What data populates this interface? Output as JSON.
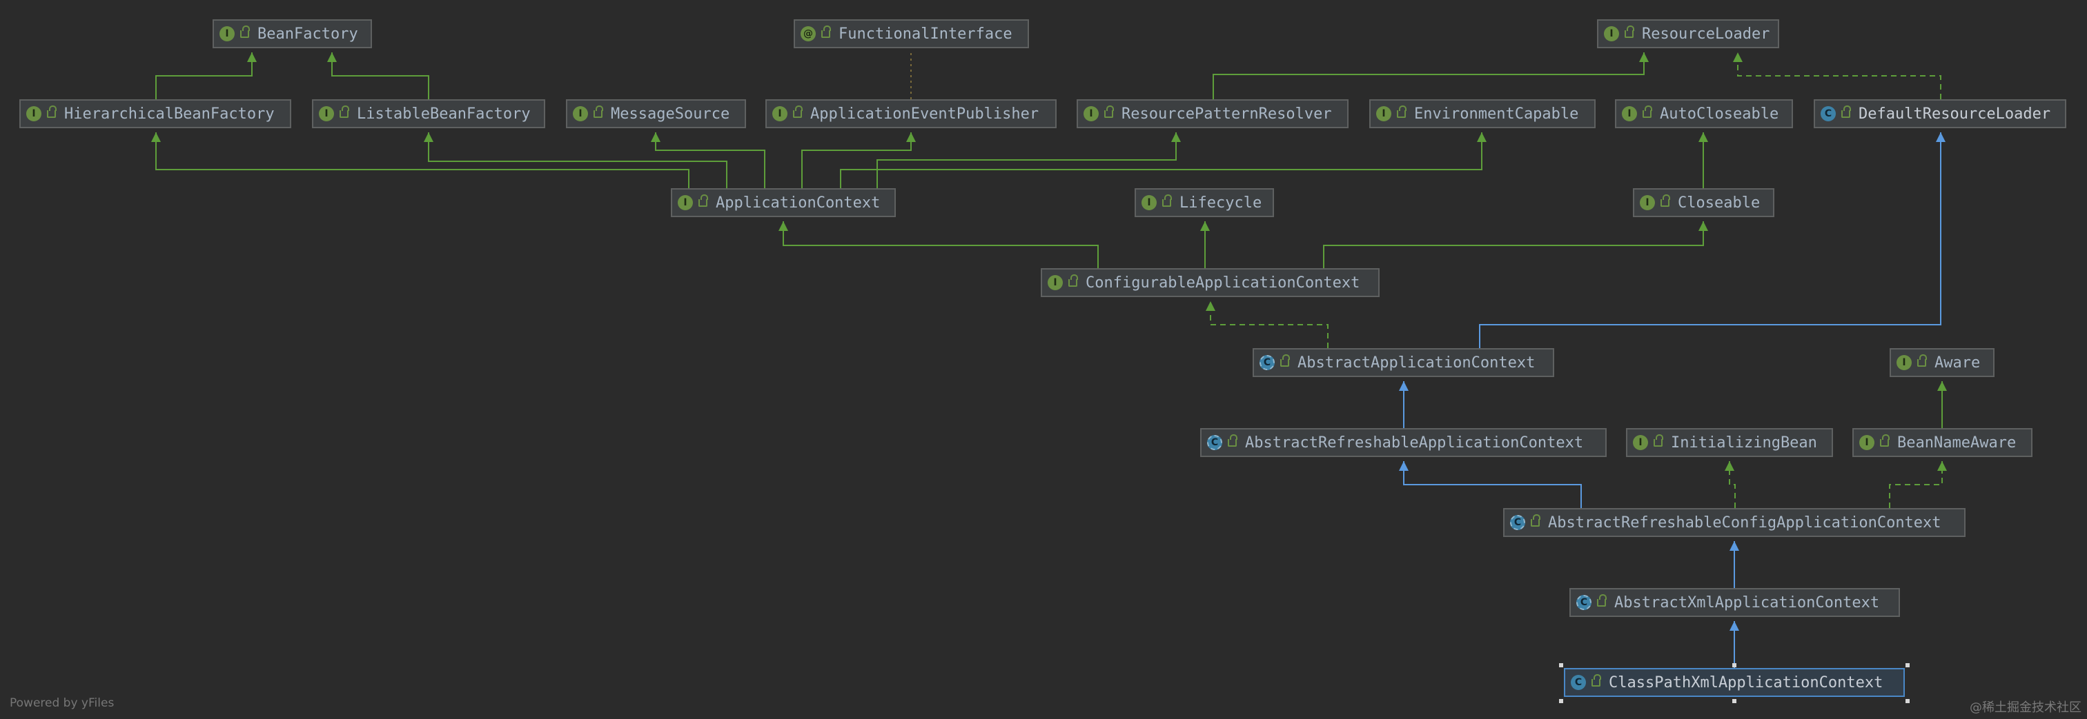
{
  "colors": {
    "background": "#2b2b2b",
    "node_fill": "#3c3f41",
    "node_border": "#5e6060",
    "extends_interface": "#5e9e3a",
    "implements": "#5e9e3a",
    "extends_class": "#5b9ae0",
    "selected_border": "#4a88c7"
  },
  "nodes": [
    {
      "id": "BeanFactory",
      "label": "BeanFactory",
      "kind": "interface"
    },
    {
      "id": "FunctionalInterface",
      "label": "FunctionalInterface",
      "kind": "annotation"
    },
    {
      "id": "ResourceLoader",
      "label": "ResourceLoader",
      "kind": "interface"
    },
    {
      "id": "HierarchicalBeanFactory",
      "label": "HierarchicalBeanFactory",
      "kind": "interface"
    },
    {
      "id": "ListableBeanFactory",
      "label": "ListableBeanFactory",
      "kind": "interface"
    },
    {
      "id": "MessageSource",
      "label": "MessageSource",
      "kind": "interface"
    },
    {
      "id": "ApplicationEventPublisher",
      "label": "ApplicationEventPublisher",
      "kind": "interface"
    },
    {
      "id": "ResourcePatternResolver",
      "label": "ResourcePatternResolver",
      "kind": "interface"
    },
    {
      "id": "EnvironmentCapable",
      "label": "EnvironmentCapable",
      "kind": "interface"
    },
    {
      "id": "AutoCloseable",
      "label": "AutoCloseable",
      "kind": "interface"
    },
    {
      "id": "DefaultResourceLoader",
      "label": "DefaultResourceLoader",
      "kind": "class"
    },
    {
      "id": "ApplicationContext",
      "label": "ApplicationContext",
      "kind": "interface"
    },
    {
      "id": "Lifecycle",
      "label": "Lifecycle",
      "kind": "interface"
    },
    {
      "id": "Closeable",
      "label": "Closeable",
      "kind": "interface"
    },
    {
      "id": "ConfigurableApplicationContext",
      "label": "ConfigurableApplicationContext",
      "kind": "interface"
    },
    {
      "id": "AbstractApplicationContext",
      "label": "AbstractApplicationContext",
      "kind": "abstract-class"
    },
    {
      "id": "Aware",
      "label": "Aware",
      "kind": "interface"
    },
    {
      "id": "AbstractRefreshableApplicationContext",
      "label": "AbstractRefreshableApplicationContext",
      "kind": "abstract-class"
    },
    {
      "id": "InitializingBean",
      "label": "InitializingBean",
      "kind": "interface"
    },
    {
      "id": "BeanNameAware",
      "label": "BeanNameAware",
      "kind": "interface"
    },
    {
      "id": "AbstractRefreshableConfigApplicationContext",
      "label": "AbstractRefreshableConfigApplicationContext",
      "kind": "abstract-class"
    },
    {
      "id": "AbstractXmlApplicationContext",
      "label": "AbstractXmlApplicationContext",
      "kind": "abstract-class"
    },
    {
      "id": "ClassPathXmlApplicationContext",
      "label": "ClassPathXmlApplicationContext",
      "kind": "class",
      "selected": true
    }
  ],
  "edges": [
    {
      "from": "HierarchicalBeanFactory",
      "to": "BeanFactory",
      "type": "extends"
    },
    {
      "from": "ListableBeanFactory",
      "to": "BeanFactory",
      "type": "extends"
    },
    {
      "from": "ApplicationEventPublisher",
      "to": "FunctionalInterface",
      "type": "annotated"
    },
    {
      "from": "ResourcePatternResolver",
      "to": "ResourceLoader",
      "type": "extends"
    },
    {
      "from": "DefaultResourceLoader",
      "to": "ResourceLoader",
      "type": "implements"
    },
    {
      "from": "ApplicationContext",
      "to": "HierarchicalBeanFactory",
      "type": "extends"
    },
    {
      "from": "ApplicationContext",
      "to": "ListableBeanFactory",
      "type": "extends"
    },
    {
      "from": "ApplicationContext",
      "to": "MessageSource",
      "type": "extends"
    },
    {
      "from": "ApplicationContext",
      "to": "ApplicationEventPublisher",
      "type": "extends"
    },
    {
      "from": "ApplicationContext",
      "to": "ResourcePatternResolver",
      "type": "extends"
    },
    {
      "from": "ApplicationContext",
      "to": "EnvironmentCapable",
      "type": "extends"
    },
    {
      "from": "Closeable",
      "to": "AutoCloseable",
      "type": "extends"
    },
    {
      "from": "ConfigurableApplicationContext",
      "to": "ApplicationContext",
      "type": "extends"
    },
    {
      "from": "ConfigurableApplicationContext",
      "to": "Lifecycle",
      "type": "extends"
    },
    {
      "from": "ConfigurableApplicationContext",
      "to": "Closeable",
      "type": "extends"
    },
    {
      "from": "AbstractApplicationContext",
      "to": "ConfigurableApplicationContext",
      "type": "implements"
    },
    {
      "from": "AbstractApplicationContext",
      "to": "DefaultResourceLoader",
      "type": "extends-class"
    },
    {
      "from": "BeanNameAware",
      "to": "Aware",
      "type": "extends"
    },
    {
      "from": "AbstractRefreshableApplicationContext",
      "to": "AbstractApplicationContext",
      "type": "extends-class"
    },
    {
      "from": "AbstractRefreshableConfigApplicationContext",
      "to": "AbstractRefreshableApplicationContext",
      "type": "extends-class"
    },
    {
      "from": "AbstractRefreshableConfigApplicationContext",
      "to": "InitializingBean",
      "type": "implements"
    },
    {
      "from": "AbstractRefreshableConfigApplicationContext",
      "to": "BeanNameAware",
      "type": "implements"
    },
    {
      "from": "AbstractXmlApplicationContext",
      "to": "AbstractRefreshableConfigApplicationContext",
      "type": "extends-class"
    },
    {
      "from": "ClassPathXmlApplicationContext",
      "to": "AbstractXmlApplicationContext",
      "type": "extends-class"
    }
  ],
  "footer": {
    "powered_by": "Powered by yFiles"
  },
  "watermark": "@稀土掘金技术社区"
}
